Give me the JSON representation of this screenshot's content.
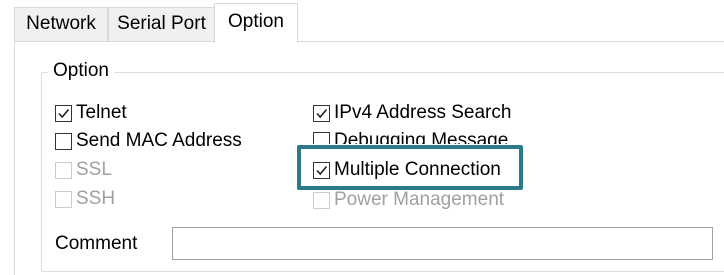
{
  "tabs": [
    {
      "label": "Network",
      "active": false
    },
    {
      "label": "Serial Port",
      "active": false
    },
    {
      "label": "Option",
      "active": true
    }
  ],
  "option_group": {
    "title": "Option",
    "checkboxes": [
      {
        "label": "Telnet",
        "checked": true,
        "enabled": true
      },
      {
        "label": "Send MAC Address",
        "checked": false,
        "enabled": true
      },
      {
        "label": "SSL",
        "checked": false,
        "enabled": false
      },
      {
        "label": "SSH",
        "checked": false,
        "enabled": false
      },
      {
        "label": "IPv4 Address Search",
        "checked": true,
        "enabled": true
      },
      {
        "label": "Debugging Message",
        "checked": false,
        "enabled": true
      },
      {
        "label": "Multiple Connection",
        "checked": true,
        "enabled": true,
        "highlighted": true
      },
      {
        "label": "Power Management",
        "checked": false,
        "enabled": false
      }
    ],
    "comment": {
      "label": "Comment",
      "value": ""
    }
  },
  "colors": {
    "highlight": "#2b7a8a",
    "disabled_text": "#a0a0a0"
  },
  "icons": {
    "check": "check-icon"
  }
}
